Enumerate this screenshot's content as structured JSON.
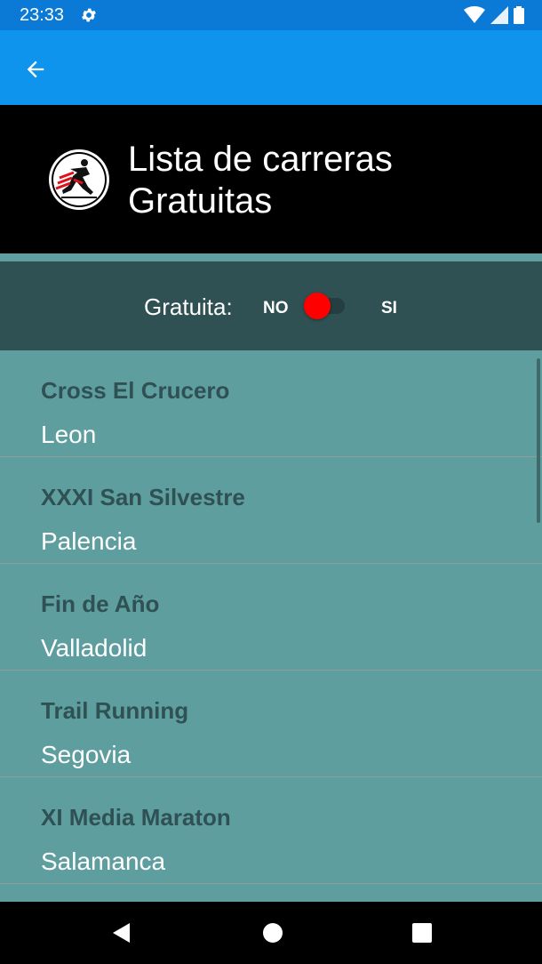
{
  "status_bar": {
    "time": "23:33",
    "icons": [
      "gear-icon",
      "wifi-icon",
      "signal-icon",
      "battery-icon"
    ]
  },
  "app_bar": {
    "back_icon": "arrow-left-icon",
    "color": "#0e94ec"
  },
  "header": {
    "title_line1": "Lista de carreras",
    "title_line2": "Gratuitas",
    "logo_icon": "runner-logo-icon"
  },
  "filter": {
    "label": "Gratuita:",
    "option_off": "NO",
    "option_on": "SI",
    "toggle_on": false,
    "toggle_color": "#ff0000"
  },
  "races": [
    {
      "name": "Cross El Crucero",
      "city": "Leon"
    },
    {
      "name": "XXXI San Silvestre",
      "city": "Palencia"
    },
    {
      "name": "Fin de Año",
      "city": "Valladolid"
    },
    {
      "name": "Trail Running",
      "city": "Segovia"
    },
    {
      "name": "XI Media Maraton",
      "city": "Salamanca"
    }
  ],
  "nav_bar": {
    "icons": [
      "back-triangle-icon",
      "home-circle-icon",
      "recents-square-icon"
    ]
  },
  "colors": {
    "list_background": "#5e9e9f",
    "filter_background": "#2f5153",
    "race_name": "#2f5153"
  }
}
